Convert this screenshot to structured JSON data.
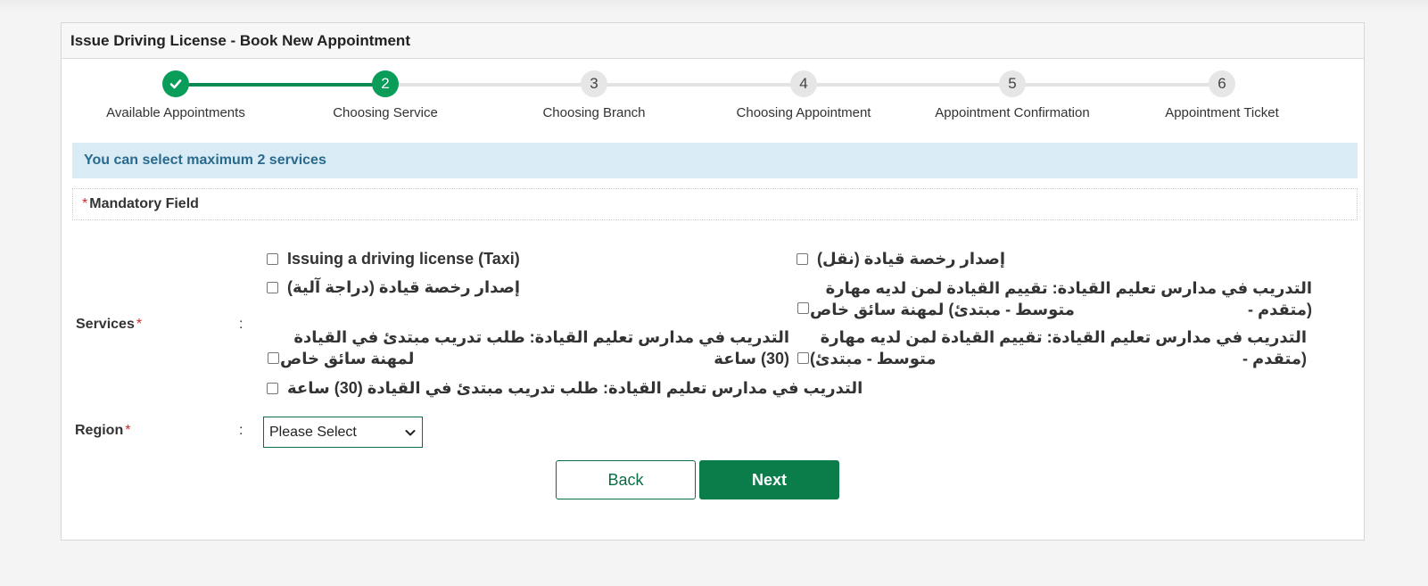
{
  "panel": {
    "title": "Issue Driving License - Book New Appointment"
  },
  "stepper": {
    "steps": [
      {
        "number": "",
        "label": "Available Appointments",
        "state": "done"
      },
      {
        "number": "2",
        "label": "Choosing Service",
        "state": "active"
      },
      {
        "number": "3",
        "label": "Choosing Branch",
        "state": "pending"
      },
      {
        "number": "4",
        "label": "Choosing Appointment",
        "state": "pending"
      },
      {
        "number": "5",
        "label": "Appointment Confirmation",
        "state": "pending"
      },
      {
        "number": "6",
        "label": "Appointment Ticket",
        "state": "pending"
      }
    ]
  },
  "info": {
    "message": "You can select maximum 2 services"
  },
  "mandatory": {
    "star": "*",
    "label": "Mandatory Field"
  },
  "form": {
    "services_label": "Services",
    "region_label": "Region",
    "required_star": "*",
    "colon": ":",
    "services": {
      "left_1": "Issuing a driving license (Taxi)",
      "left_2": "إصدار رخصة قيادة (دراجة آلية)",
      "left_3_line1": "التدريب في مدارس تعليم القيادة: طلب تدريب مبتدئ في القيادة (30) ساعة",
      "left_3_line2": "لمهنة سائق خاص",
      "left_4": "التدريب في مدارس تعليم القيادة: طلب تدريب مبتدئ في القيادة (30) ساعة",
      "right_1": "إصدار رخصة قيادة (نقل)",
      "right_2_line1": "التدريب في مدارس تعليم القيادة: تقييم القيادة لمن لديه مهارة (متقدم -",
      "right_2_line2": "متوسط - مبتدئ) لمهنة سائق خاص",
      "right_3_line1": "التدريب في مدارس تعليم القيادة: تقييم القيادة لمن لديه مهارة (متقدم -",
      "right_3_line2": "متوسط - مبتدئ)"
    },
    "region_select": {
      "selected": "Please Select"
    }
  },
  "buttons": {
    "back": "Back",
    "next": "Next"
  },
  "colors": {
    "primary_green": "#0a7d4a",
    "step_green": "#0a9d5a",
    "info_bg": "#d9ebf5",
    "info_text": "#2a6a8d"
  }
}
